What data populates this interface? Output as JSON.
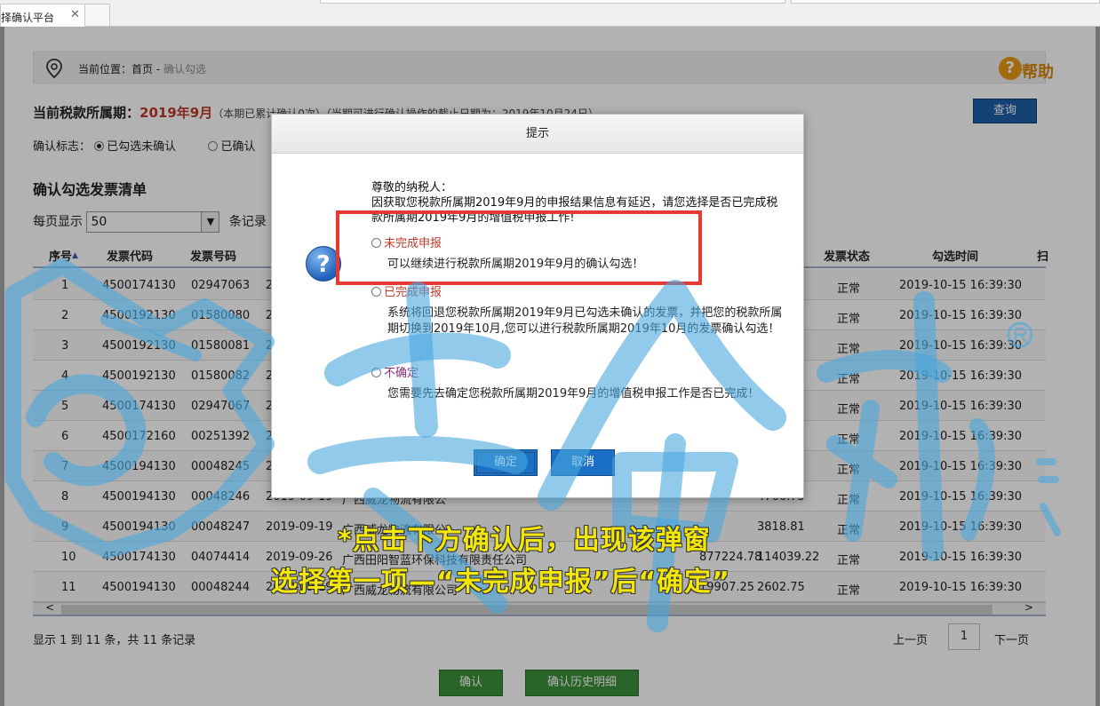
{
  "browser": {
    "tab_title": "择确认平台",
    "tab_close": "✕"
  },
  "breadcrumb": {
    "prefix": "当前位置：首页 - ",
    "current": "确认勾选",
    "help_label": "帮助"
  },
  "period": {
    "label": "当前税款所属期：",
    "value": "2019年9月",
    "note": "（本期已累计确认0次）（当期可进行确认操作的截止日期为：2019年10月24日）",
    "query_button": "查询"
  },
  "filter": {
    "label": "确认标志：",
    "options": [
      "已勾选未确认",
      "已确认"
    ],
    "selected": 0
  },
  "list": {
    "title": "确认勾选发票清单",
    "per_page_label": "每页显示",
    "per_page_value": "50",
    "per_page_suffix": "条记录",
    "columns": [
      "序号",
      "发票代码",
      "发票号码",
      "发票状态",
      "勾选时间",
      "扫"
    ],
    "rows": [
      {
        "no": "1",
        "code": "4500174130",
        "num": "02947063",
        "date": "2",
        "seller": "",
        "amount": "",
        "tax": "",
        "status": "正常",
        "time": "2019-10-15 16:39:30"
      },
      {
        "no": "2",
        "code": "4500192130",
        "num": "01580080",
        "date": "2",
        "seller": "",
        "amount": "",
        "tax": "",
        "status": "正常",
        "time": "2019-10-15 16:39:30"
      },
      {
        "no": "3",
        "code": "4500192130",
        "num": "01580081",
        "date": "2",
        "seller": "",
        "amount": "",
        "tax": "",
        "status": "正常",
        "time": "2019-10-15 16:39:30"
      },
      {
        "no": "4",
        "code": "4500192130",
        "num": "01580082",
        "date": "2",
        "seller": "",
        "amount": "",
        "tax": "",
        "status": "正常",
        "time": "2019-10-15 16:39:30"
      },
      {
        "no": "5",
        "code": "4500174130",
        "num": "02947067",
        "date": "2",
        "seller": "",
        "amount": "",
        "tax": "",
        "status": "正常",
        "time": "2019-10-15 16:39:30"
      },
      {
        "no": "6",
        "code": "4500172160",
        "num": "00251392",
        "date": "2",
        "seller": "",
        "amount": "",
        "tax": "",
        "status": "正常",
        "time": "2019-10-15 16:39:30"
      },
      {
        "no": "7",
        "code": "4500194130",
        "num": "00048245",
        "date": "2",
        "seller": "",
        "amount": "",
        "tax": "",
        "status": "正常",
        "time": "2019-10-15 16:39:30"
      },
      {
        "no": "8",
        "code": "4500194130",
        "num": "00048246",
        "date": "2019-09-19",
        "seller": "广西威龙物流有限公",
        "amount": "",
        "tax": "4766.73",
        "status": "正常",
        "time": "2019-10-15 16:39:30"
      },
      {
        "no": "9",
        "code": "4500194130",
        "num": "00048247",
        "date": "2019-09-19",
        "seller": "广西威龙物流有限公",
        "amount": "",
        "tax": "3818.81",
        "status": "正常",
        "time": "2019-10-15 16:39:30"
      },
      {
        "no": "10",
        "code": "4500174130",
        "num": "04074414",
        "date": "2019-09-26",
        "seller": "广西田阳智蓝环保科技有限责任公司",
        "amount": "877224.78",
        "tax": "114039.22",
        "status": "正常",
        "time": "2019-10-15 16:39:30"
      },
      {
        "no": "11",
        "code": "4500194130",
        "num": "00048244",
        "date": "2019-09-19",
        "seller": "广西威龙物流有限公司",
        "amount": "19907.25",
        "tax": "2602.75",
        "status": "正常",
        "time": "2019-10-15 16:39:30"
      }
    ],
    "summary": "显示 1 到 11 条，共 11 条记录",
    "prev": "上一页",
    "page": "1",
    "next": "下一页",
    "confirm_button": "确认",
    "history_button": "确认历史明细"
  },
  "modal": {
    "title": "提示",
    "greeting": "尊敬的纳税人：",
    "message": "因获取您税款所属期2019年9月的申报结果信息有延迟，请您选择是否已完成税款所属期2019年9月的增值税申报工作!",
    "options": [
      {
        "label": "未完成申报",
        "desc": "可以继续进行税款所属期2019年9月的确认勾选！"
      },
      {
        "label": "已完成申报",
        "desc": "系统将回退您税款所属期2019年9月已勾选未确认的发票，并把您的税款所属期切换到2019年10月,您可以进行税款所属期2019年10月的发票确认勾选！"
      },
      {
        "label": "不确定",
        "desc": "您需要先去确定您税款所属期2019年9月的增值税申报工作是否已完成！"
      }
    ],
    "ok": "确定",
    "cancel": "取消"
  },
  "caption": {
    "line1": "*点击下方确认后，出现该弹窗",
    "line2": "选择第一项—“未完成申报”后“确定”"
  },
  "colors": {
    "accent_red": "#c0392b",
    "button_blue": "#1b6fc4",
    "button_green": "#3a8f3a",
    "highlight_box": "#e53935",
    "caption_yellow": "#f2e60a",
    "watermark_blue": "#4aa6e0"
  }
}
